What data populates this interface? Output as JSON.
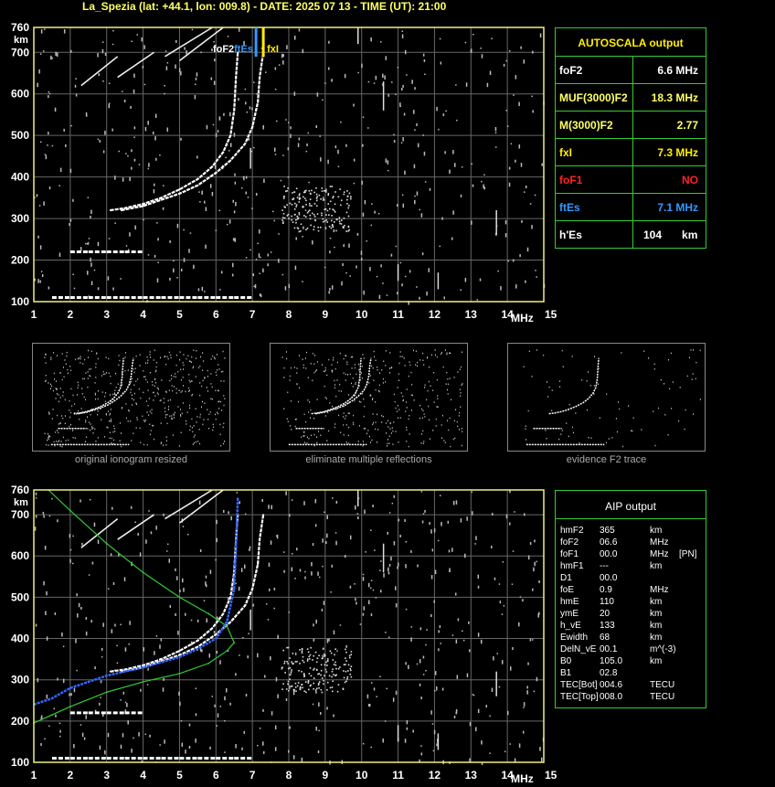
{
  "header": {
    "title": "La_Spezia (lat: +44.1, lon: 009.8) - DATE: 2025 07 13 - TIME (UT): 21:00"
  },
  "colors": {
    "axis": "#f0f080",
    "grid": "#666666",
    "trace": "#ffffff",
    "green": "#33cc33",
    "blue": "#3366ff",
    "yellow": "#ffee00",
    "red": "#ff2222",
    "title": "#ffff66"
  },
  "chart_data": [
    {
      "type": "scatter",
      "title": "",
      "xlabel": "MHz",
      "ylabel": "km",
      "xlim": [
        1,
        15
      ],
      "ylim": [
        100,
        760
      ],
      "x_ticks": [
        "1",
        "2",
        "3",
        "4",
        "5",
        "6",
        "7",
        "8",
        "9",
        "10",
        "11",
        "12",
        "13",
        "14",
        "15"
      ],
      "y_ticks": [
        "100",
        "200",
        "300",
        "400",
        "500",
        "600",
        "700",
        "760"
      ],
      "grid": true,
      "markers": [
        {
          "label": "foF2",
          "x": 6.6,
          "color": "#ffffff"
        },
        {
          "label": "ftEs",
          "x": 7.1,
          "color": "#3399ff"
        },
        {
          "label": "fxI",
          "x": 7.3,
          "color": "#ffee00"
        }
      ],
      "series": [
        {
          "name": "O trace",
          "x": [
            3.1,
            3.5,
            4.0,
            4.5,
            5.0,
            5.5,
            5.9,
            6.2,
            6.4,
            6.5,
            6.55,
            6.6
          ],
          "y": [
            320,
            325,
            335,
            350,
            370,
            395,
            425,
            460,
            500,
            560,
            640,
            700
          ]
        },
        {
          "name": "X trace",
          "x": [
            3.4,
            4.0,
            4.5,
            5.0,
            5.5,
            6.0,
            6.4,
            6.8,
            7.0,
            7.15,
            7.2,
            7.3
          ],
          "y": [
            320,
            330,
            345,
            360,
            380,
            410,
            440,
            480,
            520,
            580,
            640,
            700
          ]
        },
        {
          "name": "Es layer",
          "x": [
            1.5,
            2.0,
            2.5,
            3.0,
            3.5,
            4.0,
            4.5,
            5.0,
            5.5,
            6.0,
            6.5,
            7.0
          ],
          "y": [
            110,
            110,
            110,
            110,
            110,
            110,
            110,
            110,
            110,
            110,
            110,
            110
          ]
        },
        {
          "name": "Multiple Es",
          "x": [
            2.0,
            2.5,
            3.0,
            3.5,
            4.0
          ],
          "y": [
            220,
            220,
            220,
            220,
            220
          ]
        }
      ]
    },
    {
      "type": "scatter",
      "title": "",
      "xlabel": "MHz",
      "ylabel": "km",
      "xlim": [
        1,
        15
      ],
      "ylim": [
        100,
        760
      ],
      "x_ticks": [
        "1",
        "2",
        "3",
        "4",
        "5",
        "6",
        "7",
        "8",
        "9",
        "10",
        "11",
        "12",
        "13",
        "14",
        "15"
      ],
      "y_ticks": [
        "100",
        "200",
        "300",
        "400",
        "500",
        "600",
        "700",
        "760"
      ],
      "grid": true,
      "series": [
        {
          "name": "O trace",
          "x": [
            3.1,
            3.5,
            4.0,
            4.5,
            5.0,
            5.5,
            5.9,
            6.2,
            6.4,
            6.5,
            6.55,
            6.6
          ],
          "y": [
            320,
            325,
            335,
            350,
            370,
            395,
            425,
            460,
            500,
            560,
            640,
            700
          ]
        },
        {
          "name": "X trace",
          "x": [
            3.4,
            4.0,
            4.5,
            5.0,
            5.5,
            6.0,
            6.4,
            6.8,
            7.0,
            7.15,
            7.2,
            7.3
          ],
          "y": [
            320,
            330,
            345,
            360,
            380,
            410,
            440,
            480,
            520,
            580,
            640,
            700
          ]
        },
        {
          "name": "Es layer",
          "x": [
            1.5,
            2.0,
            2.5,
            3.0,
            3.5,
            4.0,
            4.5,
            5.0,
            5.5,
            6.0,
            6.5,
            7.0
          ],
          "y": [
            110,
            110,
            110,
            110,
            110,
            110,
            110,
            110,
            110,
            110,
            110,
            110
          ]
        },
        {
          "name": "Multiple Es",
          "x": [
            2.0,
            2.5,
            3.0,
            3.5,
            4.0
          ],
          "y": [
            220,
            220,
            220,
            220,
            220
          ]
        },
        {
          "name": "Profile (green)",
          "x": [
            1.0,
            1.5,
            2.0,
            3.0,
            4.0,
            5.0,
            5.8,
            6.3,
            6.5,
            6.3,
            5.8,
            5.0,
            4.0,
            3.0,
            2.0,
            1.4
          ],
          "y": [
            195,
            215,
            235,
            270,
            295,
            315,
            340,
            370,
            390,
            430,
            460,
            500,
            560,
            630,
            710,
            760
          ]
        },
        {
          "name": "Fitted trace (blue)",
          "x": [
            1.0,
            1.5,
            2.0,
            3.0,
            4.0,
            5.0,
            5.5,
            6.0,
            6.3,
            6.5,
            6.55,
            6.6
          ],
          "y": [
            240,
            255,
            280,
            310,
            330,
            355,
            375,
            400,
            440,
            520,
            620,
            740
          ]
        }
      ]
    }
  ],
  "thumbnails": [
    {
      "caption": "original ionogram resized"
    },
    {
      "caption": "eliminate multiple reflections"
    },
    {
      "caption": "evidence F2 trace"
    }
  ],
  "autoscala": {
    "title": "AUTOSCALA output",
    "rows": [
      {
        "key": "foF2",
        "value": "6.6 MHz",
        "key_color": "#ffffff",
        "value_color": "#ffffff"
      },
      {
        "key": "MUF(3000)F2",
        "value": "18.3 MHz",
        "key_color": "#ffff66",
        "value_color": "#ffff66"
      },
      {
        "key": "M(3000)F2",
        "value": "2.77",
        "key_color": "#ffff66",
        "value_color": "#ffff66"
      },
      {
        "key": "fxI",
        "value": "7.3 MHz",
        "key_color": "#ffee00",
        "value_color": "#ffee00"
      },
      {
        "key": "foF1",
        "value": "NO",
        "key_color": "#ff2222",
        "value_color": "#ff2222"
      },
      {
        "key": "ftEs",
        "value": "7.1 MHz",
        "key_color": "#3399ff",
        "value_color": "#3399ff"
      },
      {
        "key": "h'Es",
        "value": "104",
        "unit": "km",
        "key_color": "#ffffff",
        "value_color": "#ffffff"
      }
    ]
  },
  "aip": {
    "title": "AIP output",
    "rows": [
      {
        "key": "hmF2",
        "value": "365",
        "unit": "km",
        "extra": ""
      },
      {
        "key": "foF2",
        "value": "06.6",
        "unit": "MHz",
        "extra": ""
      },
      {
        "key": "foF1",
        "value": "00.0",
        "unit": "MHz",
        "extra": "[PN]"
      },
      {
        "key": "hmF1",
        "value": "---",
        "unit": "km",
        "extra": ""
      },
      {
        "key": "D1",
        "value": "00.0",
        "unit": "",
        "extra": ""
      },
      {
        "key": "foE",
        "value": "0.9",
        "unit": "MHz",
        "extra": ""
      },
      {
        "key": "hmE",
        "value": "110",
        "unit": "km",
        "extra": ""
      },
      {
        "key": "ymE",
        "value": "20",
        "unit": "km",
        "extra": ""
      },
      {
        "key": "h_vE",
        "value": "133",
        "unit": "km",
        "extra": ""
      },
      {
        "key": "Ewidth",
        "value": "68",
        "unit": "km",
        "extra": ""
      },
      {
        "key": "DelN_vE",
        "value": "00.1",
        "unit": "m^(-3)",
        "extra": ""
      },
      {
        "key": "B0",
        "value": "105.0",
        "unit": "km",
        "extra": ""
      },
      {
        "key": "B1",
        "value": "02.8",
        "unit": "",
        "extra": ""
      },
      {
        "key": "TEC[Bot]",
        "value": "004.6",
        "unit": "TECU",
        "extra": ""
      },
      {
        "key": "TEC[Top]",
        "value": "008.0",
        "unit": "TECU",
        "extra": ""
      }
    ]
  }
}
